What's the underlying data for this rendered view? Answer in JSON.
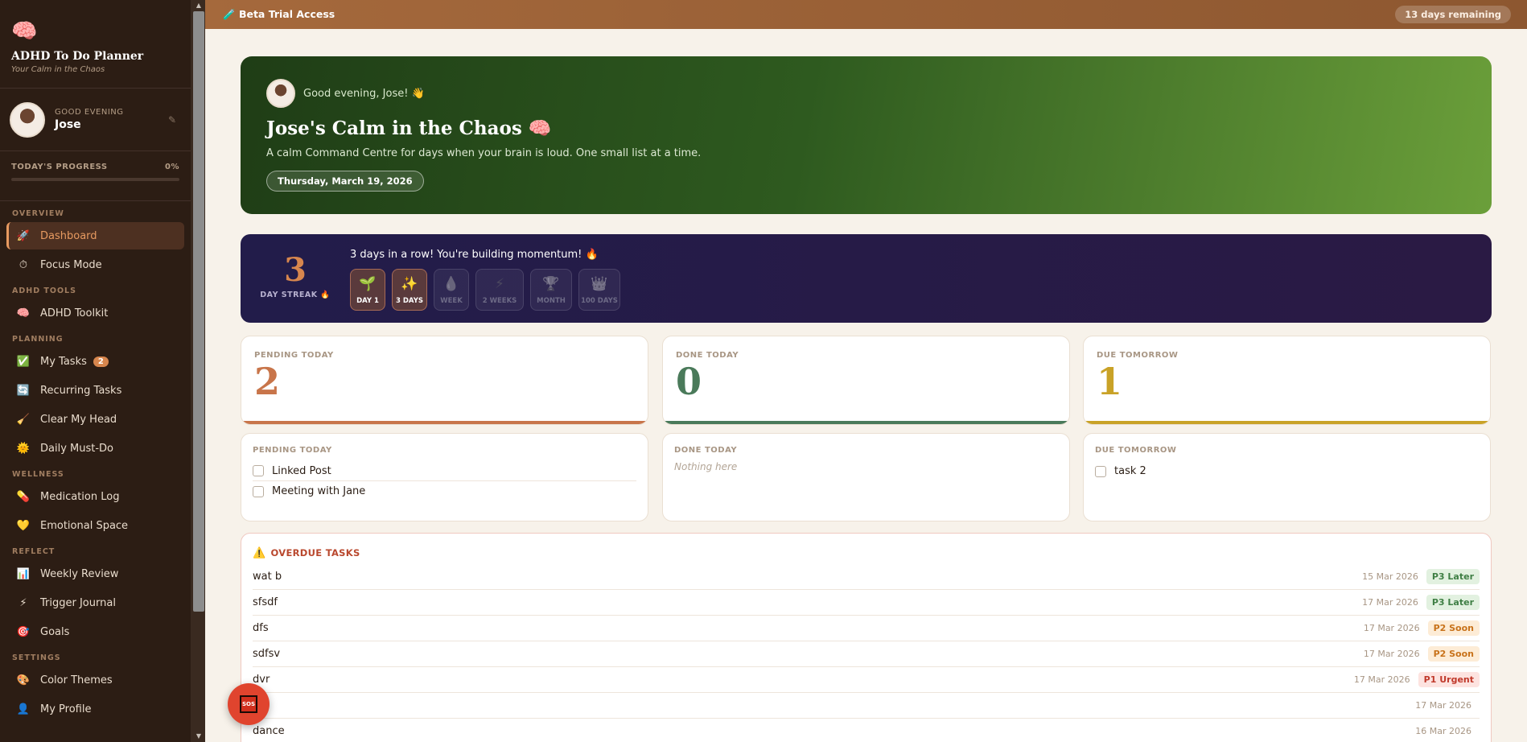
{
  "sidebar": {
    "brand": {
      "logo": "🧠",
      "title": "ADHD To Do Planner",
      "subtitle": "Your Calm in the Chaos"
    },
    "user": {
      "greeting": "GOOD EVENING",
      "name": "Jose",
      "edit_icon": "✎"
    },
    "progress": {
      "label": "TODAY'S PROGRESS",
      "value": "0%",
      "fraction": 0
    },
    "sections": [
      {
        "label": "OVERVIEW",
        "items": [
          {
            "icon": "🚀",
            "label": "Dashboard",
            "active": true
          },
          {
            "icon": "⏱",
            "label": "Focus Mode"
          }
        ]
      },
      {
        "label": "ADHD TOOLS",
        "items": [
          {
            "icon": "🧠",
            "label": "ADHD Toolkit"
          }
        ]
      },
      {
        "label": "PLANNING",
        "items": [
          {
            "icon": "✅",
            "label": "My Tasks",
            "badge": "2"
          },
          {
            "icon": "🔄",
            "label": "Recurring Tasks"
          },
          {
            "icon": "🧹",
            "label": "Clear My Head"
          },
          {
            "icon": "🌞",
            "label": "Daily Must-Do"
          }
        ]
      },
      {
        "label": "WELLNESS",
        "items": [
          {
            "icon": "💊",
            "label": "Medication Log"
          },
          {
            "icon": "💛",
            "label": "Emotional Space"
          }
        ]
      },
      {
        "label": "REFLECT",
        "items": [
          {
            "icon": "📊",
            "label": "Weekly Review"
          },
          {
            "icon": "⚡",
            "label": "Trigger Journal"
          },
          {
            "icon": "🎯",
            "label": "Goals"
          }
        ]
      },
      {
        "label": "SETTINGS",
        "items": [
          {
            "icon": "🎨",
            "label": "Color Themes"
          },
          {
            "icon": "👤",
            "label": "My Profile"
          }
        ]
      }
    ]
  },
  "topbar": {
    "beta_icon": "🧪",
    "beta_label": "Beta Trial Access",
    "remaining": "13 days remaining"
  },
  "hero": {
    "greeting": "Good evening, Jose! 👋",
    "title": "Jose's Calm in the Chaos 🧠",
    "description": "A calm Command Centre for days when your brain is loud. One small list at a time.",
    "date": "Thursday, March 19, 2026"
  },
  "streak": {
    "count": "3",
    "label": "DAY STREAK 🔥",
    "message": "3 days in a row! You're building momentum! 🔥",
    "badges": [
      {
        "icon": "🌱",
        "label": "DAY 1",
        "earned": true
      },
      {
        "icon": "✨",
        "label": "3 DAYS",
        "earned": true
      },
      {
        "icon": "💧",
        "label": "WEEK",
        "earned": false
      },
      {
        "icon": "⚡",
        "label": "2 WEEKS",
        "earned": false
      },
      {
        "icon": "🏆",
        "label": "MONTH",
        "earned": false
      },
      {
        "icon": "👑",
        "label": "100 DAYS",
        "earned": false
      }
    ]
  },
  "stats": [
    {
      "label": "PENDING TODAY",
      "value": "2",
      "color": "#c8754a"
    },
    {
      "label": "DONE TODAY",
      "value": "0",
      "color": "#4a7a5a"
    },
    {
      "label": "DUE TOMORROW",
      "value": "1",
      "color": "#c9a227"
    }
  ],
  "lists": {
    "pending": {
      "label": "PENDING TODAY",
      "items": [
        "Linked Post",
        "Meeting with Jane"
      ]
    },
    "done": {
      "label": "DONE TODAY",
      "empty": "Nothing here"
    },
    "tomorrow": {
      "label": "DUE TOMORROW",
      "items": [
        "task 2"
      ]
    }
  },
  "overdue": {
    "icon": "⚠️",
    "title": "OVERDUE TASKS",
    "rows": [
      {
        "name": "wat b",
        "date": "15 Mar 2026",
        "priority": "P3 Later",
        "level": "p3"
      },
      {
        "name": "sfsdf",
        "date": "17 Mar 2026",
        "priority": "P3 Later",
        "level": "p3"
      },
      {
        "name": "dfs",
        "date": "17 Mar 2026",
        "priority": "P2 Soon",
        "level": "p2"
      },
      {
        "name": "sdfsv",
        "date": "17 Mar 2026",
        "priority": "P2 Soon",
        "level": "p2"
      },
      {
        "name": "dvr",
        "date": "17 Mar 2026",
        "priority": "P1 Urgent",
        "level": "p1"
      },
      {
        "name": "",
        "date": "17 Mar 2026",
        "priority": "",
        "level": ""
      },
      {
        "name": "dance",
        "date": "16 Mar 2026",
        "priority": "",
        "level": ""
      }
    ]
  },
  "sos": {
    "label": "SOS"
  },
  "colors": {
    "p1_bg": "#fde3e0",
    "p1_fg": "#c0392b",
    "p2_bg": "#fdecd6",
    "p2_fg": "#c8721a",
    "p3_bg": "#e2f1e0",
    "p3_fg": "#3f7f45"
  }
}
